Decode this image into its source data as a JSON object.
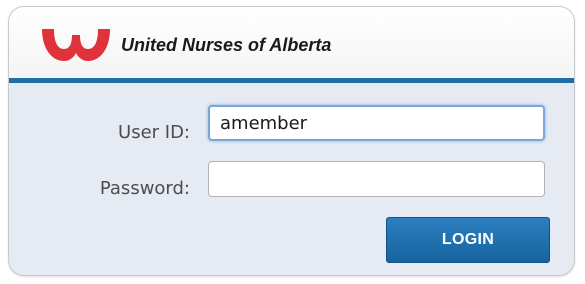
{
  "header": {
    "organization_name": "United Nurses of Alberta",
    "logo_icon": "una-logo-icon",
    "logo_color": "#e0323a",
    "rule_color": "#1f6ea6"
  },
  "form": {
    "user_id_label": "User ID:",
    "user_id_value": "amember",
    "password_label": "Password:",
    "password_value": "",
    "login_label": "LOGIN"
  },
  "colors": {
    "panel_background": "#e5eaf3",
    "button_background": "#1d6eae",
    "focus_ring": "#7aa7d6"
  }
}
